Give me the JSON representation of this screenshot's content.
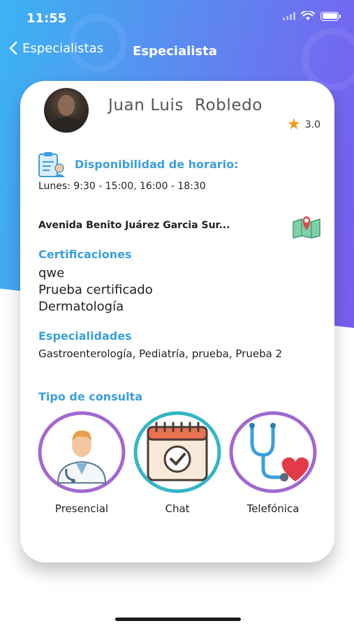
{
  "status_bar": {
    "time": "11:55"
  },
  "nav": {
    "back_label": "Especialistas",
    "title": "Especialista"
  },
  "doctor": {
    "name": "Juan Luis  Robledo",
    "rating": "3.0"
  },
  "availability": {
    "title": "Disponibilidad de horario:",
    "value": "Lunes: 9:30 - 15:00, 16:00 - 18:30"
  },
  "address": "Avenida Benito Juárez Garcia Sur...",
  "certifications": {
    "title": "Certificaciones",
    "items": [
      "qwe",
      "Prueba certificado",
      "Dermatología"
    ]
  },
  "specialties": {
    "title": "Especialidades",
    "value": "Gastroenterología, Pediatría, prueba, Prueba 2"
  },
  "consultation": {
    "title": "Tipo de consulta",
    "options": [
      {
        "label": "Presencial",
        "icon": "doctor-icon",
        "ring_color": "#a268cf"
      },
      {
        "label": "Chat",
        "icon": "calendar-check-icon",
        "ring_color": "#34b6c6"
      },
      {
        "label": "Telefónica",
        "icon": "stethoscope-heart-icon",
        "ring_color": "#a268cf"
      }
    ]
  },
  "colors": {
    "accent": "#3c9fdc",
    "star": "#f59a1b",
    "gradient_start": "#3bb4f2",
    "gradient_end": "#7a5cf0"
  }
}
